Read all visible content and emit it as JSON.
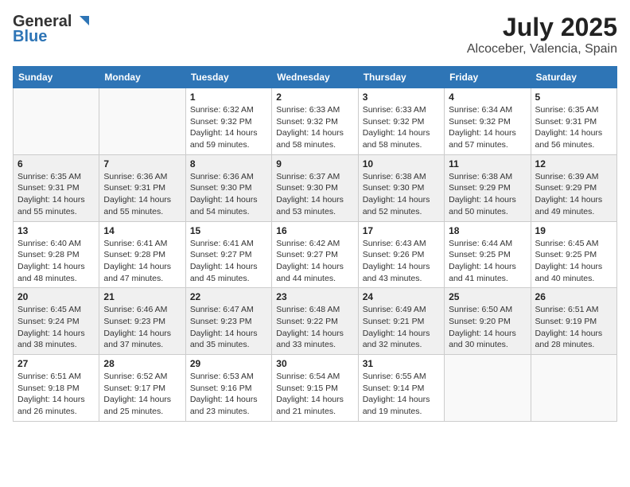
{
  "header": {
    "logo_general": "General",
    "logo_blue": "Blue",
    "title": "July 2025",
    "subtitle": "Alcoceber, Valencia, Spain"
  },
  "weekdays": [
    "Sunday",
    "Monday",
    "Tuesday",
    "Wednesday",
    "Thursday",
    "Friday",
    "Saturday"
  ],
  "weeks": [
    [
      {
        "day": null,
        "info": null
      },
      {
        "day": null,
        "info": null
      },
      {
        "day": "1",
        "info": "Sunrise: 6:32 AM\nSunset: 9:32 PM\nDaylight: 14 hours and 59 minutes."
      },
      {
        "day": "2",
        "info": "Sunrise: 6:33 AM\nSunset: 9:32 PM\nDaylight: 14 hours and 58 minutes."
      },
      {
        "day": "3",
        "info": "Sunrise: 6:33 AM\nSunset: 9:32 PM\nDaylight: 14 hours and 58 minutes."
      },
      {
        "day": "4",
        "info": "Sunrise: 6:34 AM\nSunset: 9:32 PM\nDaylight: 14 hours and 57 minutes."
      },
      {
        "day": "5",
        "info": "Sunrise: 6:35 AM\nSunset: 9:31 PM\nDaylight: 14 hours and 56 minutes."
      }
    ],
    [
      {
        "day": "6",
        "info": "Sunrise: 6:35 AM\nSunset: 9:31 PM\nDaylight: 14 hours and 55 minutes."
      },
      {
        "day": "7",
        "info": "Sunrise: 6:36 AM\nSunset: 9:31 PM\nDaylight: 14 hours and 55 minutes."
      },
      {
        "day": "8",
        "info": "Sunrise: 6:36 AM\nSunset: 9:30 PM\nDaylight: 14 hours and 54 minutes."
      },
      {
        "day": "9",
        "info": "Sunrise: 6:37 AM\nSunset: 9:30 PM\nDaylight: 14 hours and 53 minutes."
      },
      {
        "day": "10",
        "info": "Sunrise: 6:38 AM\nSunset: 9:30 PM\nDaylight: 14 hours and 52 minutes."
      },
      {
        "day": "11",
        "info": "Sunrise: 6:38 AM\nSunset: 9:29 PM\nDaylight: 14 hours and 50 minutes."
      },
      {
        "day": "12",
        "info": "Sunrise: 6:39 AM\nSunset: 9:29 PM\nDaylight: 14 hours and 49 minutes."
      }
    ],
    [
      {
        "day": "13",
        "info": "Sunrise: 6:40 AM\nSunset: 9:28 PM\nDaylight: 14 hours and 48 minutes."
      },
      {
        "day": "14",
        "info": "Sunrise: 6:41 AM\nSunset: 9:28 PM\nDaylight: 14 hours and 47 minutes."
      },
      {
        "day": "15",
        "info": "Sunrise: 6:41 AM\nSunset: 9:27 PM\nDaylight: 14 hours and 45 minutes."
      },
      {
        "day": "16",
        "info": "Sunrise: 6:42 AM\nSunset: 9:27 PM\nDaylight: 14 hours and 44 minutes."
      },
      {
        "day": "17",
        "info": "Sunrise: 6:43 AM\nSunset: 9:26 PM\nDaylight: 14 hours and 43 minutes."
      },
      {
        "day": "18",
        "info": "Sunrise: 6:44 AM\nSunset: 9:25 PM\nDaylight: 14 hours and 41 minutes."
      },
      {
        "day": "19",
        "info": "Sunrise: 6:45 AM\nSunset: 9:25 PM\nDaylight: 14 hours and 40 minutes."
      }
    ],
    [
      {
        "day": "20",
        "info": "Sunrise: 6:45 AM\nSunset: 9:24 PM\nDaylight: 14 hours and 38 minutes."
      },
      {
        "day": "21",
        "info": "Sunrise: 6:46 AM\nSunset: 9:23 PM\nDaylight: 14 hours and 37 minutes."
      },
      {
        "day": "22",
        "info": "Sunrise: 6:47 AM\nSunset: 9:23 PM\nDaylight: 14 hours and 35 minutes."
      },
      {
        "day": "23",
        "info": "Sunrise: 6:48 AM\nSunset: 9:22 PM\nDaylight: 14 hours and 33 minutes."
      },
      {
        "day": "24",
        "info": "Sunrise: 6:49 AM\nSunset: 9:21 PM\nDaylight: 14 hours and 32 minutes."
      },
      {
        "day": "25",
        "info": "Sunrise: 6:50 AM\nSunset: 9:20 PM\nDaylight: 14 hours and 30 minutes."
      },
      {
        "day": "26",
        "info": "Sunrise: 6:51 AM\nSunset: 9:19 PM\nDaylight: 14 hours and 28 minutes."
      }
    ],
    [
      {
        "day": "27",
        "info": "Sunrise: 6:51 AM\nSunset: 9:18 PM\nDaylight: 14 hours and 26 minutes."
      },
      {
        "day": "28",
        "info": "Sunrise: 6:52 AM\nSunset: 9:17 PM\nDaylight: 14 hours and 25 minutes."
      },
      {
        "day": "29",
        "info": "Sunrise: 6:53 AM\nSunset: 9:16 PM\nDaylight: 14 hours and 23 minutes."
      },
      {
        "day": "30",
        "info": "Sunrise: 6:54 AM\nSunset: 9:15 PM\nDaylight: 14 hours and 21 minutes."
      },
      {
        "day": "31",
        "info": "Sunrise: 6:55 AM\nSunset: 9:14 PM\nDaylight: 14 hours and 19 minutes."
      },
      {
        "day": null,
        "info": null
      },
      {
        "day": null,
        "info": null
      }
    ]
  ]
}
